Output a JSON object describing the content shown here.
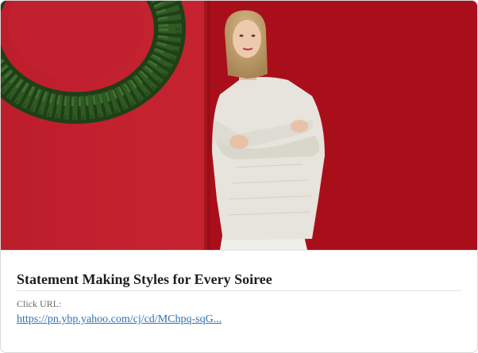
{
  "ad": {
    "image_alt": "Woman in a white knit sweater standing in front of a red wall with a green wreath",
    "headline": "Statement Making Styles for Every Soiree",
    "click_label": "Click URL:",
    "click_url": "https://pn.ybp.yahoo.com/cj/cd/MChpq-sqG..."
  },
  "colors": {
    "wall_left": "#c1202e",
    "wall_right": "#a90f1a",
    "wreath": "#2f5a23",
    "sweater": "#e6e4dc",
    "link": "#2f6fb3"
  }
}
